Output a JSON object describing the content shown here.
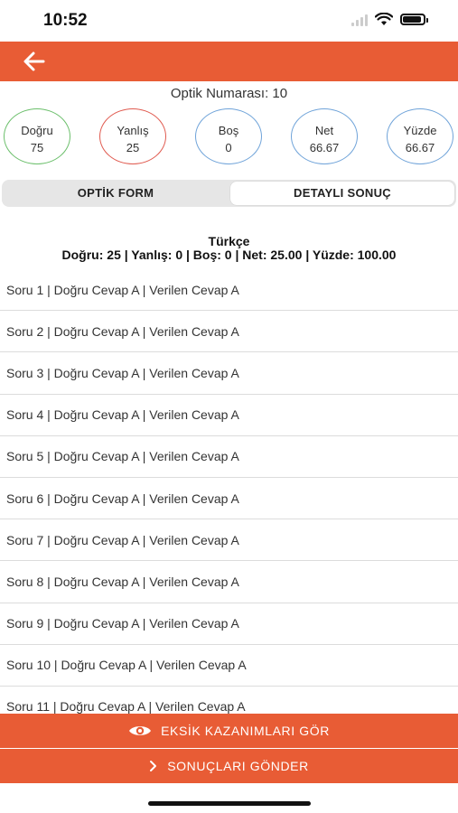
{
  "status_bar": {
    "time": "10:52",
    "battery_level": 0.9
  },
  "header": {
    "back_icon": "arrow-left-icon",
    "color": "#e85c35"
  },
  "optik": {
    "title": "Optik Numarası: 10"
  },
  "stats": [
    {
      "label": "Doğru",
      "value": "75",
      "color": "#6bbf6b"
    },
    {
      "label": "Yanlış",
      "value": "25",
      "color": "#e05a4f"
    },
    {
      "label": "Boş",
      "value": "0",
      "color": "#6fa3d9"
    },
    {
      "label": "Net",
      "value": "66.67",
      "color": "#6fa3d9"
    },
    {
      "label": "Yüzde",
      "value": "66.67",
      "color": "#6fa3d9"
    }
  ],
  "tabs": [
    {
      "label": "OPTİK FORM",
      "active": false
    },
    {
      "label": "DETAYLI SONUÇ",
      "active": true
    }
  ],
  "section": {
    "title": "Türkçe",
    "summary": "Doğru: 25 | Yanlış: 0 | Boş: 0 | Net: 25.00  | Yüzde: 100.00"
  },
  "questions": [
    "Soru 1 | Doğru Cevap A | Verilen Cevap A",
    "Soru 2 | Doğru Cevap A | Verilen Cevap A",
    "Soru 3 | Doğru Cevap A | Verilen Cevap A",
    "Soru 4 | Doğru Cevap A | Verilen Cevap A",
    "Soru 5 | Doğru Cevap A | Verilen Cevap A",
    "Soru 6 | Doğru Cevap A | Verilen Cevap A",
    "Soru 7 | Doğru Cevap A | Verilen Cevap A",
    "Soru 8 | Doğru Cevap A | Verilen Cevap A",
    "Soru 9 | Doğru Cevap A | Verilen Cevap A",
    "Soru 10 | Doğru Cevap A | Verilen Cevap A",
    "Soru 11 | Doğru Cevap A | Verilen Cevap A"
  ],
  "buttons": {
    "missing": {
      "label": "EKSİK KAZANIMLARI GÖR",
      "icon": "eye-icon"
    },
    "send": {
      "label": "SONUÇLARI GÖNDER",
      "icon": "chevron-right-icon"
    }
  }
}
